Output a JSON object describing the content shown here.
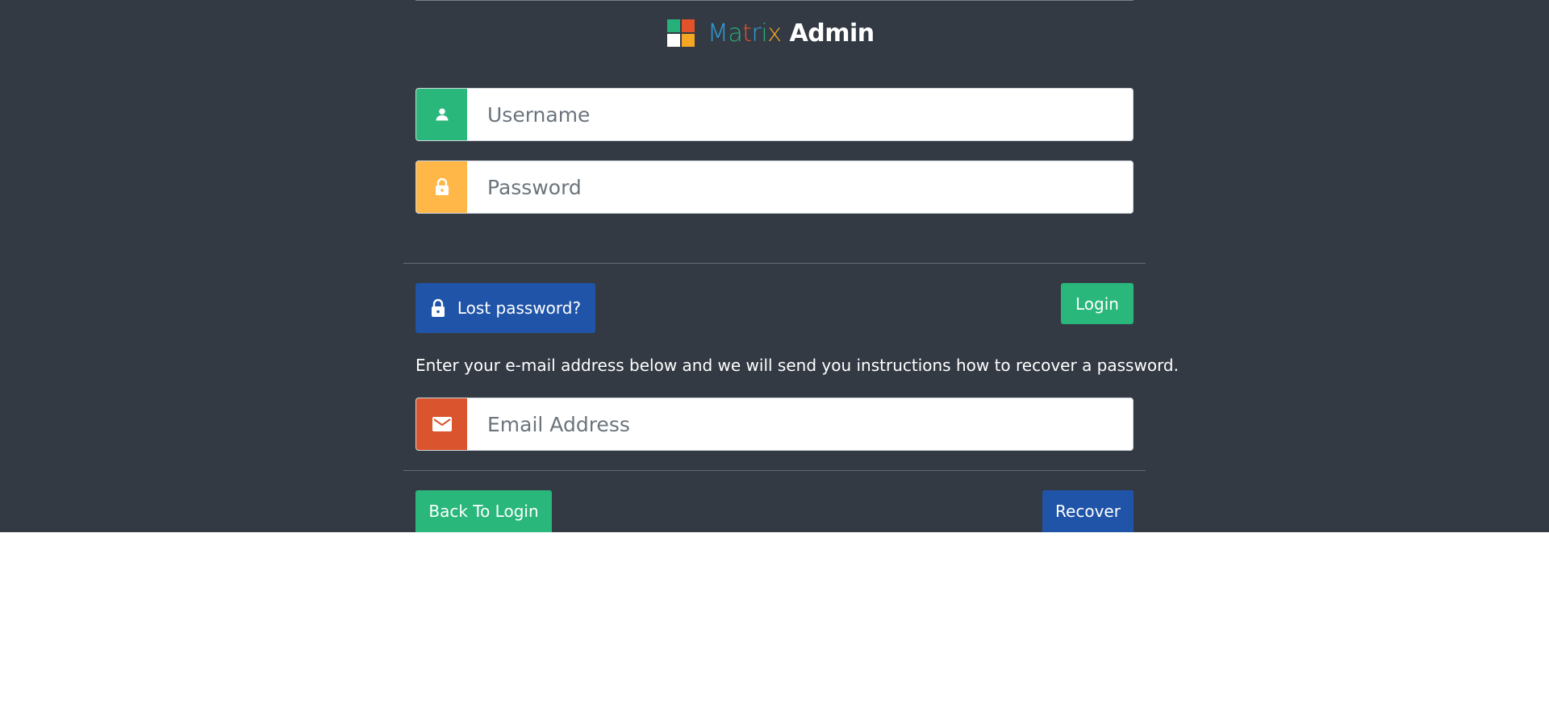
{
  "brand": {
    "letters": [
      {
        "char": "M",
        "color": "#2d9fd8"
      },
      {
        "char": "a",
        "color": "#27b07a"
      },
      {
        "char": "t",
        "color": "#e2522b"
      },
      {
        "char": "r",
        "color": "#2d9fd8"
      },
      {
        "char": "i",
        "color": "#27b07a"
      },
      {
        "char": "x",
        "color": "#f5a623"
      }
    ],
    "word2": "Admin",
    "logo_colors": [
      "#27b07a",
      "#e2522b",
      "#ffffff",
      "#f5a623"
    ]
  },
  "login_form": {
    "username": {
      "placeholder": "Username",
      "value": "",
      "icon": "user-icon",
      "addon_color": "#2ab77b"
    },
    "password": {
      "placeholder": "Password",
      "value": "",
      "icon": "lock-icon",
      "addon_color": "#ffb848"
    }
  },
  "actions": {
    "lost_password_label": "Lost password?",
    "login_label": "Login"
  },
  "recover": {
    "instructions": "Enter your e-mail address below and we will send you instructions how to recover a password.",
    "email": {
      "placeholder": "Email Address",
      "value": "",
      "icon": "mail-icon",
      "addon_color": "#da542e"
    },
    "back_label": "Back To Login",
    "recover_label": "Recover"
  },
  "colors": {
    "background": "#343a44",
    "green": "#2ab77b",
    "blue": "#1f54a8",
    "orange": "#ffb848",
    "red": "#da542e"
  }
}
